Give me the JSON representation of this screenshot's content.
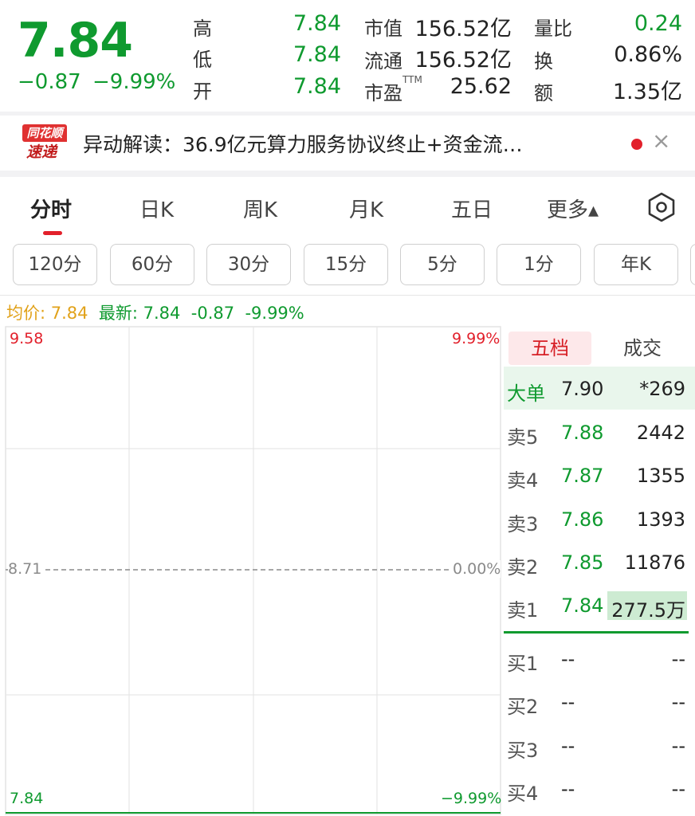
{
  "quote": {
    "price": "7.84",
    "change": "−0.87",
    "change_pct": "−9.99%",
    "stats": [
      {
        "label": "高",
        "value": "7.84",
        "green": true
      },
      {
        "label": "低",
        "value": "7.84",
        "green": true
      },
      {
        "label": "开",
        "value": "7.84",
        "green": true
      },
      {
        "label": "市值",
        "value": "156.52亿",
        "green": false
      },
      {
        "label": "流通",
        "value": "156.52亿",
        "green": false
      },
      {
        "label": "市盈",
        "value": "25.62",
        "green": false
      },
      {
        "label": "量比",
        "value": "0.24",
        "green": true
      },
      {
        "label": "换",
        "value": "0.86%",
        "green": false
      },
      {
        "label": "额",
        "value": "1.35亿",
        "green": false
      }
    ],
    "pe_sup": "TTM"
  },
  "news": {
    "logo_top": "同花顺",
    "logo_bottom": "速递",
    "text": "异动解读：36.9亿元算力服务协议终止+资金流…",
    "close_icon": "close-icon"
  },
  "period_tabs": [
    "分时",
    "日K",
    "周K",
    "月K",
    "五日",
    "更多▴"
  ],
  "active_period": "分时",
  "settings_icon": "hexagon-gear-icon",
  "interval_chips": [
    "120分",
    "60分",
    "30分",
    "15分",
    "5分",
    "1分",
    "年K"
  ],
  "legend": {
    "avg_label": "均价: 7.84",
    "latest_label": "最新: 7.84",
    "change": "-0.87",
    "change_pct": "-9.99%"
  },
  "chart": {
    "top_price": "9.58",
    "top_pct": "9.99%",
    "mid_price": "8.71",
    "mid_pct": "0.00%",
    "bottom_price": "7.84",
    "bottom_pct": "−9.99%",
    "colors": {
      "up": "#e2202b",
      "down": "#0f9a2f",
      "flat": "#888888"
    }
  },
  "orderbook": {
    "tabs": [
      "五档",
      "成交"
    ],
    "active_tab": "五档",
    "big_order": {
      "label": "大单",
      "price": "7.90",
      "volume": "*269"
    },
    "asks": [
      {
        "label": "卖5",
        "price": "7.88",
        "volume": "2442"
      },
      {
        "label": "卖4",
        "price": "7.87",
        "volume": "1355"
      },
      {
        "label": "卖3",
        "price": "7.86",
        "volume": "1393"
      },
      {
        "label": "卖2",
        "price": "7.85",
        "volume": "11876"
      },
      {
        "label": "卖1",
        "price": "7.84",
        "volume": "277.5万"
      }
    ],
    "bids": [
      {
        "label": "买1",
        "price": "--",
        "volume": "--"
      },
      {
        "label": "买2",
        "price": "--",
        "volume": "--"
      },
      {
        "label": "买3",
        "price": "--",
        "volume": "--"
      },
      {
        "label": "买4",
        "price": "--",
        "volume": "--"
      }
    ]
  }
}
